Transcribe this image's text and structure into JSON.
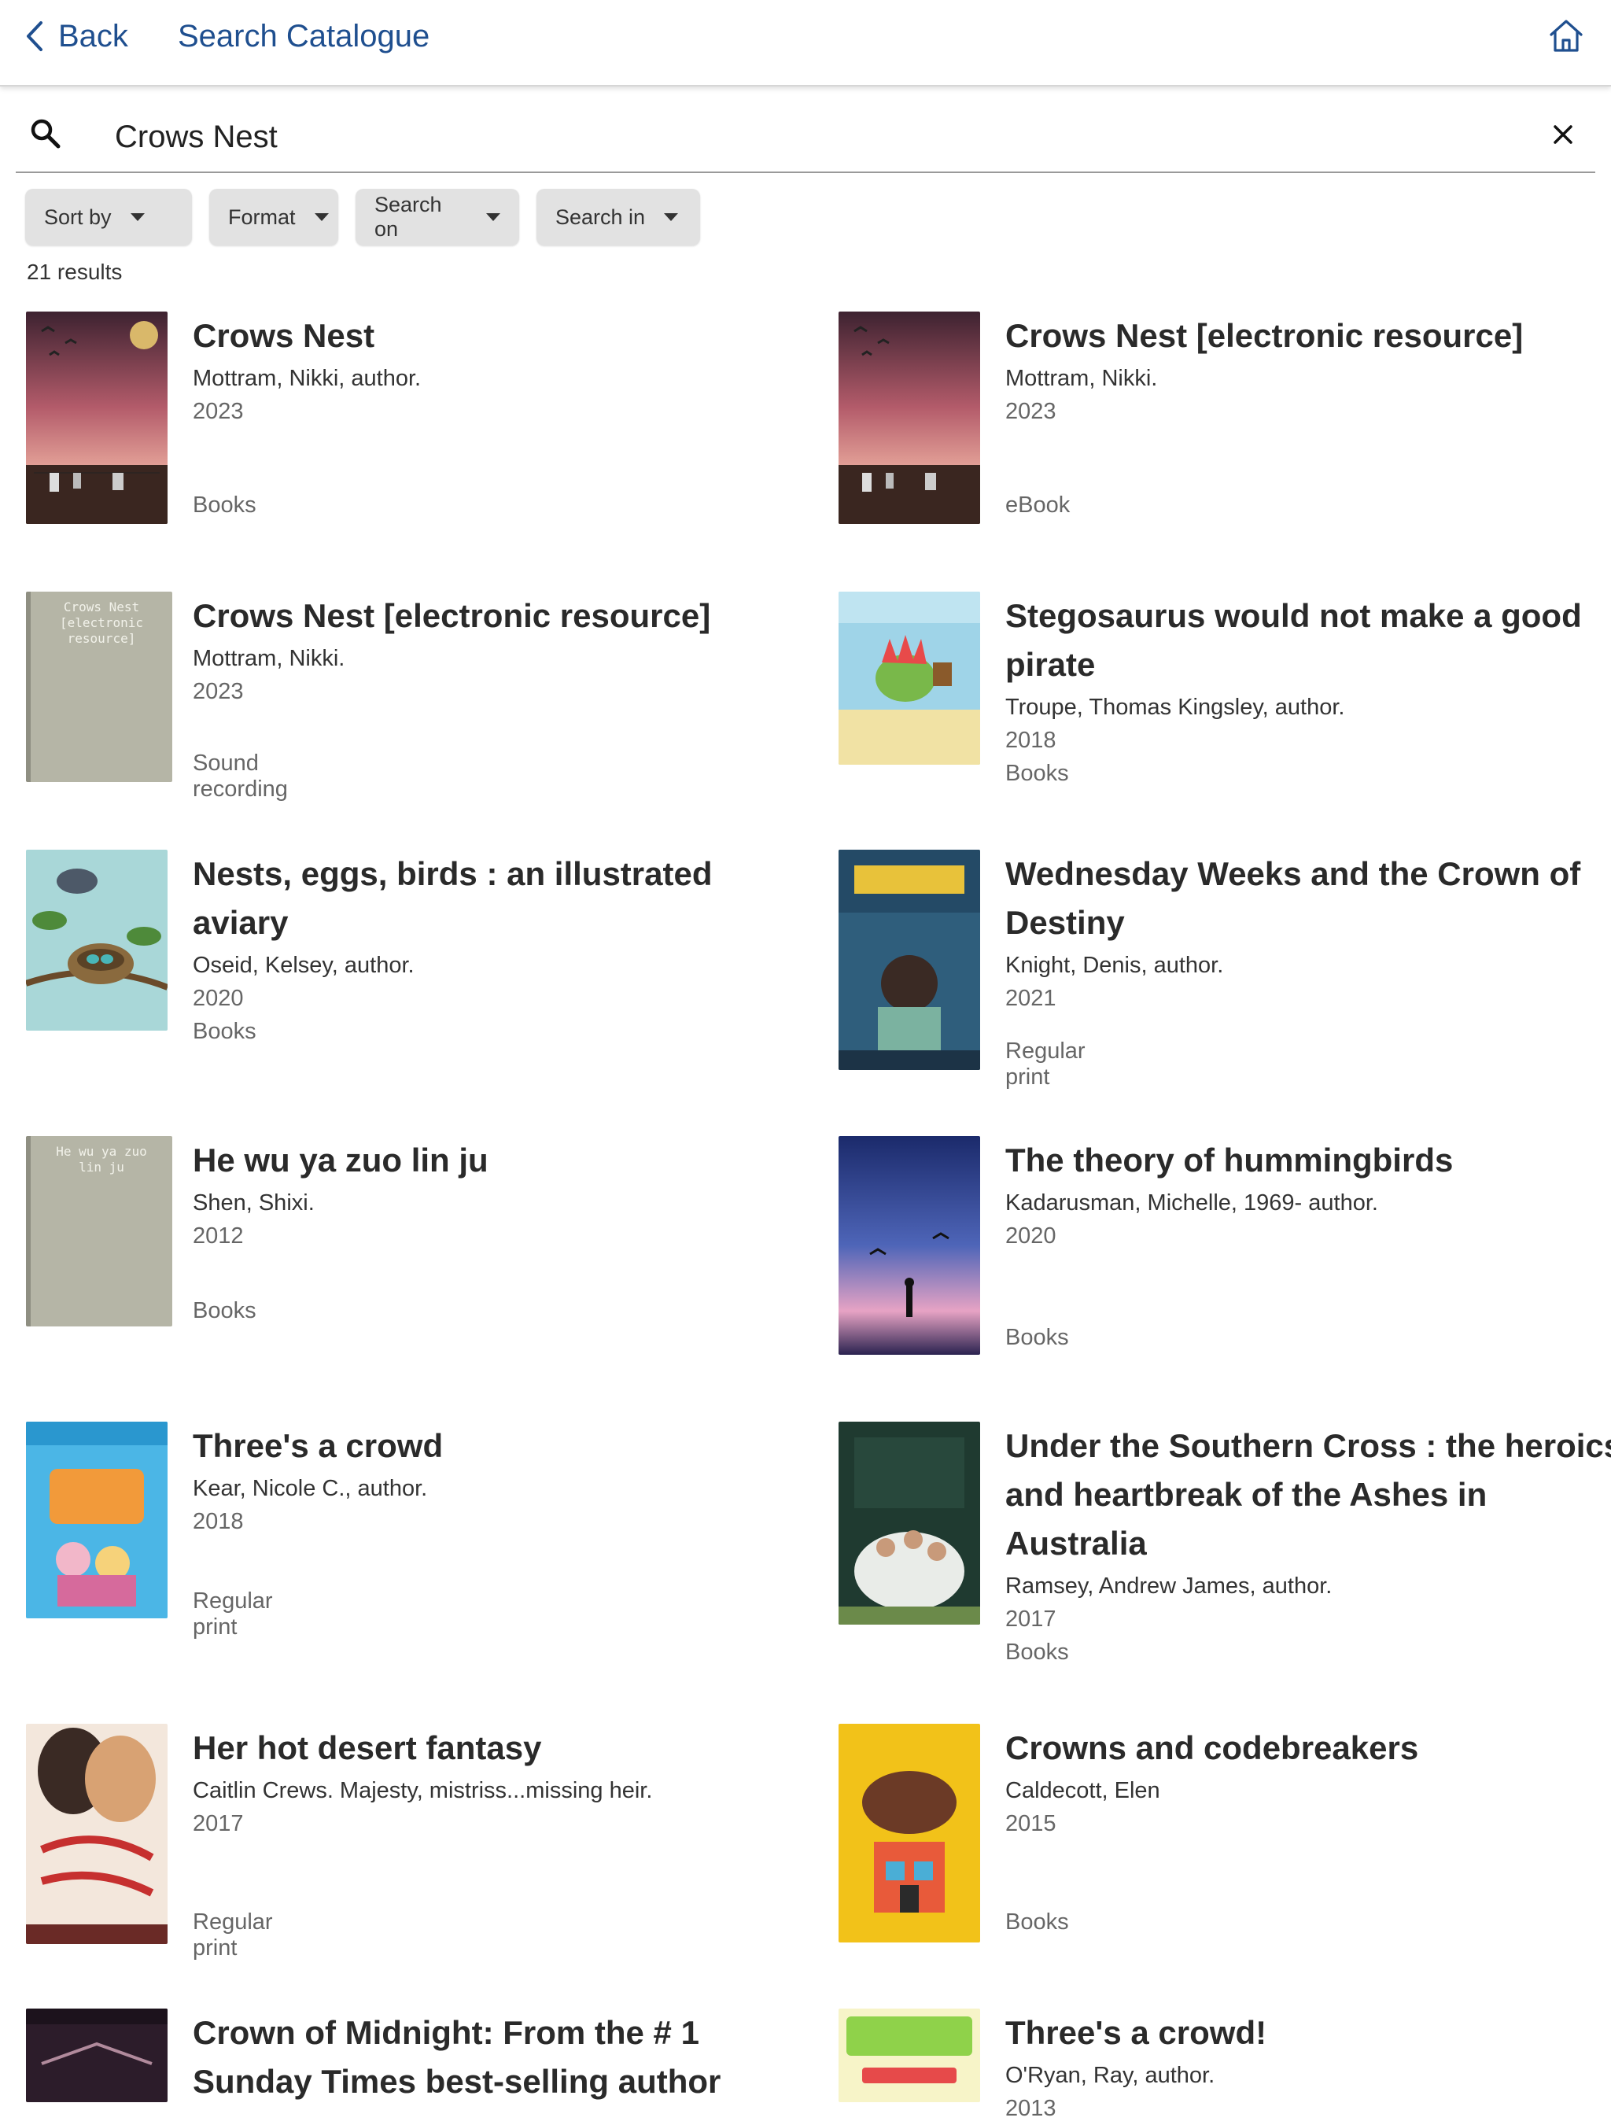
{
  "header": {
    "back_label": "Back",
    "title": "Search Catalogue",
    "home_icon": "home-icon"
  },
  "search": {
    "value": "Crows Nest",
    "icon": "search-icon",
    "clear_icon": "close-icon"
  },
  "filters": [
    {
      "label": "Sort by"
    },
    {
      "label": "Format"
    },
    {
      "label": "Search on"
    },
    {
      "label": "Search in"
    }
  ],
  "results_count": "21 results",
  "results": [
    {
      "title": "Crows Nest",
      "author": "Mottram, Nikki, author.",
      "year": "2023",
      "format": "Books"
    },
    {
      "title": "Crows Nest [electronic resource]",
      "author": "Mottram, Nikki.",
      "year": "2023",
      "format": "eBook"
    },
    {
      "title": "Crows Nest [electronic resource]",
      "author": "Mottram, Nikki.",
      "year": "2023",
      "format": "Sound recording",
      "cover_text": "Crows Nest [electronic resource]"
    },
    {
      "title": "Stegosaurus would not make a good pirate",
      "author": "Troupe, Thomas Kingsley, author.",
      "year": "2018",
      "format": "Books"
    },
    {
      "title": "Nests, eggs, birds : an illustrated aviary",
      "author": "Oseid, Kelsey, author.",
      "year": "2020",
      "format": "Books"
    },
    {
      "title": "Wednesday Weeks and the Crown of Destiny",
      "author": "Knight, Denis, author.",
      "year": "2021",
      "format": "Regular print"
    },
    {
      "title": "He wu ya zuo lin ju",
      "author": "Shen, Shixi.",
      "year": "2012",
      "format": "Books",
      "cover_text": "He wu ya zuo lin ju"
    },
    {
      "title": "The theory of hummingbirds",
      "author": "Kadarusman, Michelle, 1969- author.",
      "year": "2020",
      "format": "Books"
    },
    {
      "title": "Three's a crowd",
      "author": "Kear, Nicole C., author.",
      "year": "2018",
      "format": "Regular print"
    },
    {
      "title": "Under the Southern Cross : the heroics and heartbreak of the Ashes in Australia",
      "author": "Ramsey, Andrew James, author.",
      "year": "2017",
      "format": "Books"
    },
    {
      "title": "Her hot desert fantasy",
      "author": "Caitlin Crews. Majesty, mistriss...missing heir.",
      "year": "2017",
      "format": "Regular print"
    },
    {
      "title": "Crowns and codebreakers",
      "author": "Caldecott, Elen",
      "year": "2015",
      "format": "Books"
    },
    {
      "title": "Crown of Midnight: From the # 1 Sunday Times best-selling author",
      "author": "",
      "year": "",
      "format": ""
    },
    {
      "title": "Three's a crowd!",
      "author": "O'Ryan, Ray, author.",
      "year": "2013",
      "format": ""
    }
  ]
}
